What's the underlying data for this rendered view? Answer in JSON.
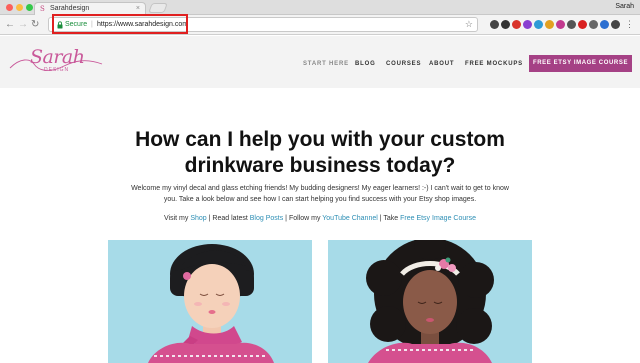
{
  "browser": {
    "tab_title": "Sarahdesign",
    "favicon": "S",
    "tab_close": "×",
    "user": "Sarah",
    "secure_label": "Secure",
    "url": "https://www.sarahdesign.com",
    "colors": {
      "secure": "#1a8e3c",
      "highlight": "#e02020"
    },
    "extensions": [
      {
        "name": "extension-icon-1",
        "color": "#444444"
      },
      {
        "name": "extension-icon-2",
        "color": "#333333"
      },
      {
        "name": "extension-icon-3",
        "color": "#d9332b"
      },
      {
        "name": "extension-icon-4",
        "color": "#8a3fd1"
      },
      {
        "name": "extension-icon-5",
        "color": "#2e9bd6"
      },
      {
        "name": "extension-icon-6",
        "color": "#e2a020"
      },
      {
        "name": "extension-icon-7",
        "color": "#c23a8f"
      },
      {
        "name": "extension-icon-8",
        "color": "#555555"
      },
      {
        "name": "extension-icon-9",
        "color": "#d92020"
      },
      {
        "name": "extension-icon-10",
        "color": "#666666"
      },
      {
        "name": "extension-icon-11",
        "color": "#2c6fd1"
      },
      {
        "name": "extension-icon-12",
        "color": "#444444"
      }
    ]
  },
  "site": {
    "logo_word": "Sarah",
    "logo_sub": "DESIGN",
    "brand_color": "#c9599a",
    "nav": {
      "start_here": "START HERE",
      "blog": "BLOG",
      "courses": "COURSES",
      "about": "ABOUT",
      "free_mockups": "FREE MOCKUPS"
    },
    "cta": "FREE ETSY IMAGE COURSE",
    "cta_color": "#a54185"
  },
  "main": {
    "headline": "How can I help you with your custom drinkware business today?",
    "intro": "Welcome my vinyl decal and glass etching friends! My budding designers! My eager learners! :-) I can't wait to get to know you. Take a look below and see how I can start helping you find success with your Etsy shop images.",
    "links": {
      "visit_prefix": "Visit my ",
      "shop": "Shop",
      "read_prefix": " | Read latest ",
      "blog_posts": "Blog Posts",
      "follow_prefix": " | Follow my ",
      "youtube": "YouTube Channel",
      "take_prefix": "  |  Take ",
      "course": "Free Etsy Image Course"
    },
    "link_color": "#2e8fb5",
    "card_bg": "#a7dbe8"
  }
}
